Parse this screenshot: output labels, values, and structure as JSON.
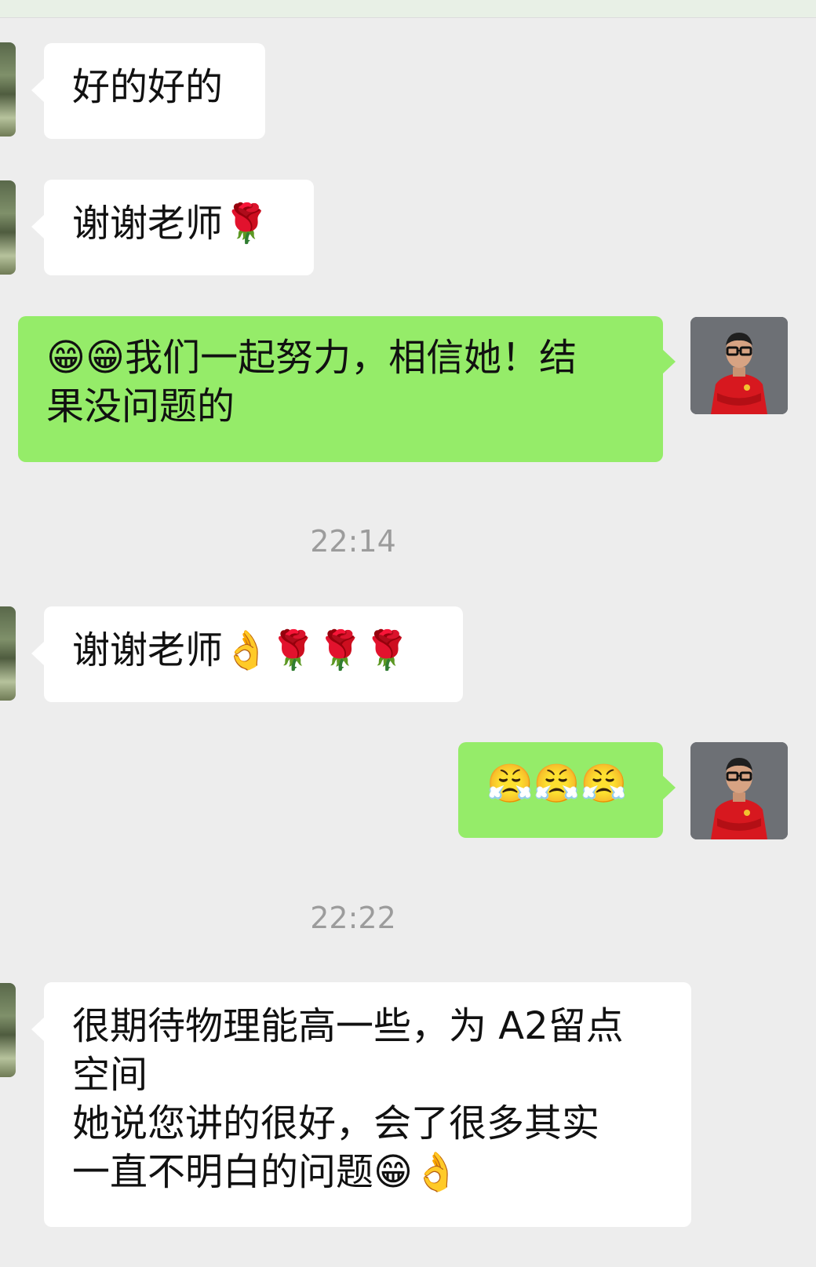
{
  "chat": {
    "messages": [
      {
        "side": "incoming",
        "text": "好的好的"
      },
      {
        "side": "incoming",
        "text": "谢谢老师🌹"
      },
      {
        "side": "outgoing",
        "lines": [
          "😁😁我们一起努力，相信她！结",
          "果没问题的"
        ]
      },
      {
        "timestamp": "22:14"
      },
      {
        "side": "incoming",
        "text": "谢谢老师👌🌹🌹🌹"
      },
      {
        "side": "outgoing",
        "text": "😤😤😤"
      },
      {
        "timestamp": "22:22"
      },
      {
        "side": "incoming",
        "lines": [
          "很期待物理能高一些，为 A2留点",
          "空间",
          "她说您讲的很好，会了很多其实",
          "一直不明白的问题😁👌"
        ]
      }
    ]
  }
}
